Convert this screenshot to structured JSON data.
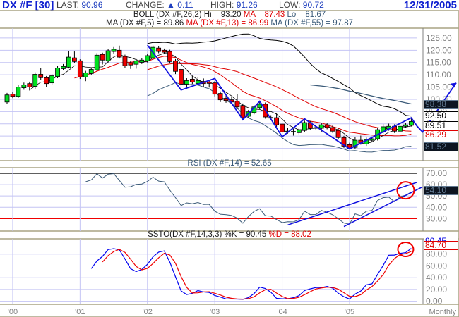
{
  "header": {
    "symbol": "DX #F [30]",
    "last_label": "LAST:",
    "last_value": "90.96",
    "change_label": "CHANGE:",
    "change_icon": "triangle-up-icon",
    "change_value": "0.11",
    "high_label": "HIGH:",
    "high_value": "91.26",
    "low_label": "LOW:",
    "low_value": "90.72",
    "date": "12/31/2005"
  },
  "legends": {
    "boll": {
      "name": "BOLL (DX #F,26,2) Hi = 93.20",
      "ma": "MA = 87.43",
      "lo": "Lo = 81.67"
    },
    "ma": {
      "ma5": "MA (DX #F,5) = 89.86",
      "ma13": "MA (DX #F,13) = 86.99",
      "ma55": "MA (DX #F,55) = 97.87"
    },
    "rsi": "RSI (DX #F,14) = 52.65",
    "ssto": {
      "k": "SSTO(DX #F,14,3,3) %K = 90.45",
      "d": "%D = 88.02"
    }
  },
  "value_boxes": {
    "main": [
      "98.38",
      "92.50",
      "89.51",
      "86.29",
      "81.52"
    ],
    "rsi": "54.10",
    "ssto_k": "90.45",
    "ssto_d": "84.70"
  },
  "x_axis": {
    "labels": [
      "'00",
      "'01",
      "'02",
      "'03",
      "'04",
      "'05"
    ],
    "label_months": [
      "2000-01",
      "2001-01",
      "2002-01",
      "2003-01",
      "2004-01",
      "2005-01"
    ],
    "periodicity": "Monthly"
  },
  "colors": {
    "up": "#00e020",
    "down": "#f00000",
    "grid": "#c4c4f4",
    "frame": "#a8a484",
    "bands": "#000000",
    "ma_red": "#e00000",
    "slate": "#3a5a78",
    "annotation": "#1010e0",
    "k": "#0000f0",
    "d": "#f00000"
  },
  "chart_data": [
    {
      "type": "candlestick",
      "periodicity": "Monthly",
      "ylim": [
        75,
        129
      ],
      "yticks": [
        "125.00",
        "120.00",
        "115.00",
        "110.00",
        "105.00",
        "100.00",
        "95.00",
        "90.00",
        "85.00",
        "80.00"
      ],
      "ytick_values": [
        125,
        120,
        115,
        110,
        105,
        100,
        95,
        90,
        85,
        80
      ],
      "grid": true,
      "dates": [
        "1999-12",
        "2000-01",
        "2000-02",
        "2000-03",
        "2000-04",
        "2000-05",
        "2000-06",
        "2000-07",
        "2000-08",
        "2000-09",
        "2000-10",
        "2000-11",
        "2000-12",
        "2001-01",
        "2001-02",
        "2001-03",
        "2001-04",
        "2001-05",
        "2001-06",
        "2001-07",
        "2001-08",
        "2001-09",
        "2001-10",
        "2001-11",
        "2001-12",
        "2002-01",
        "2002-02",
        "2002-03",
        "2002-04",
        "2002-05",
        "2002-06",
        "2002-07",
        "2002-08",
        "2002-09",
        "2002-10",
        "2002-11",
        "2002-12",
        "2003-01",
        "2003-02",
        "2003-03",
        "2003-04",
        "2003-05",
        "2003-06",
        "2003-07",
        "2003-08",
        "2003-09",
        "2003-10",
        "2003-11",
        "2003-12",
        "2004-01",
        "2004-02",
        "2004-03",
        "2004-04",
        "2004-05",
        "2004-06",
        "2004-07",
        "2004-08",
        "2004-09",
        "2004-10",
        "2004-11",
        "2004-12",
        "2005-01",
        "2005-02",
        "2005-03",
        "2005-04",
        "2005-05",
        "2005-06",
        "2005-07",
        "2005-08",
        "2005-09",
        "2005-10",
        "2005-11",
        "2005-12"
      ],
      "ohlc": [
        [
          98.9,
          102.6,
          98.1,
          101.8
        ],
        [
          102.1,
          103.0,
          100.5,
          101.2
        ],
        [
          101.2,
          105.8,
          100.6,
          105.0
        ],
        [
          104.7,
          106.8,
          103.9,
          105.9
        ],
        [
          106.4,
          107.2,
          103.6,
          105.0
        ],
        [
          105.3,
          111.0,
          104.2,
          110.2
        ],
        [
          110.2,
          112.9,
          108.0,
          108.8
        ],
        [
          108.8,
          109.5,
          105.1,
          106.4
        ],
        [
          106.7,
          110.3,
          106.0,
          109.6
        ],
        [
          109.3,
          113.6,
          108.6,
          112.8
        ],
        [
          112.5,
          114.4,
          111.8,
          113.4
        ],
        [
          113.1,
          119.6,
          112.6,
          117.2
        ],
        [
          116.9,
          119.5,
          114.8,
          115.4
        ],
        [
          115.7,
          116.3,
          108.3,
          109.1
        ],
        [
          109.1,
          111.6,
          107.4,
          110.8
        ],
        [
          110.5,
          112.9,
          109.8,
          112.2
        ],
        [
          112.0,
          118.8,
          111.5,
          118.0
        ],
        [
          118.3,
          119.0,
          114.2,
          116.0
        ],
        [
          115.7,
          120.5,
          115.0,
          119.8
        ],
        [
          119.5,
          121.3,
          118.7,
          120.4
        ],
        [
          120.0,
          121.9,
          116.6,
          117.2
        ],
        [
          117.5,
          118.2,
          112.9,
          113.7
        ],
        [
          114.9,
          115.6,
          112.4,
          114.0
        ],
        [
          114.3,
          116.4,
          112.5,
          115.7
        ],
        [
          115.1,
          116.7,
          114.4,
          116.0
        ],
        [
          115.7,
          118.5,
          115.0,
          117.8
        ],
        [
          116.9,
          121.9,
          116.2,
          121.2
        ],
        [
          120.9,
          121.6,
          118.8,
          119.5
        ],
        [
          120.0,
          120.7,
          118.5,
          119.2
        ],
        [
          119.5,
          120.2,
          114.7,
          115.4
        ],
        [
          115.7,
          116.4,
          110.3,
          111.4
        ],
        [
          112.2,
          112.9,
          105.3,
          106.2
        ],
        [
          106.2,
          108.6,
          104.2,
          107.6
        ],
        [
          108.2,
          109.5,
          106.3,
          107.0
        ],
        [
          106.4,
          108.9,
          105.7,
          107.6
        ],
        [
          107.3,
          108.5,
          105.0,
          106.4
        ],
        [
          107.0,
          107.8,
          104.8,
          106.5
        ],
        [
          106.7,
          107.4,
          101.2,
          102.1
        ],
        [
          102.4,
          103.2,
          98.9,
          99.8
        ],
        [
          100.4,
          101.5,
          98.6,
          99.5
        ],
        [
          99.8,
          101.0,
          98.0,
          98.9
        ],
        [
          99.2,
          102.2,
          96.0,
          96.9
        ],
        [
          97.5,
          98.3,
          91.8,
          92.5
        ],
        [
          93.1,
          95.7,
          92.4,
          94.9
        ],
        [
          94.6,
          97.6,
          93.9,
          96.9
        ],
        [
          96.6,
          99.4,
          95.9,
          98.0
        ],
        [
          98.0,
          98.7,
          92.1,
          92.8
        ],
        [
          92.6,
          93.5,
          91.6,
          92.5
        ],
        [
          92.5,
          94.2,
          88.8,
          89.6
        ],
        [
          89.9,
          90.6,
          85.9,
          86.7
        ],
        [
          86.7,
          88.2,
          86.0,
          87.0
        ],
        [
          86.8,
          88.0,
          85.2,
          86.9
        ],
        [
          86.4,
          88.4,
          85.7,
          87.6
        ],
        [
          87.3,
          91.3,
          86.6,
          90.5
        ],
        [
          90.5,
          91.2,
          87.5,
          88.2
        ],
        [
          88.5,
          89.5,
          87.7,
          88.2
        ],
        [
          88.2,
          90.3,
          86.8,
          89.6
        ],
        [
          89.6,
          90.3,
          87.8,
          88.5
        ],
        [
          88.5,
          89.4,
          86.3,
          87.0
        ],
        [
          87.3,
          88.1,
          83.6,
          84.4
        ],
        [
          84.4,
          85.1,
          80.2,
          80.9
        ],
        [
          81.5,
          82.3,
          79.8,
          80.0
        ],
        [
          80.4,
          84.5,
          79.9,
          83.3
        ],
        [
          83.3,
          85.2,
          81.5,
          82.1
        ],
        [
          81.8,
          84.4,
          81.0,
          83.6
        ],
        [
          83.3,
          84.8,
          82.6,
          83.9
        ],
        [
          83.9,
          88.4,
          83.2,
          87.6
        ],
        [
          86.7,
          89.9,
          86.0,
          88.8
        ],
        [
          87.9,
          90.1,
          87.2,
          89.0
        ],
        [
          89.0,
          89.8,
          86.3,
          87.0
        ],
        [
          87.0,
          89.7,
          85.8,
          89.0
        ],
        [
          89.0,
          90.5,
          88.4,
          89.6
        ],
        [
          89.4,
          92.2,
          88.9,
          90.96
        ]
      ],
      "overlays": [
        "BOLL 26,2",
        "MA 5",
        "MA 13",
        "MA 55"
      ],
      "annotations": {
        "zigzag": [
          [
            "2002-01",
            122.1
          ],
          [
            "2002-07",
            103.8
          ],
          [
            "2003-01",
            108.5
          ],
          [
            "2003-06",
            91.7
          ],
          [
            "2003-09",
            99.2
          ],
          [
            "2004-01",
            84.7
          ],
          [
            "2004-05",
            92.0
          ],
          [
            "2005-01",
            79.8
          ],
          [
            "2005-12",
            92.5
          ],
          [
            "2006-01",
            89.1
          ],
          [
            "2006-02",
            86.7
          ],
          [
            "2006-08",
            106.7
          ]
        ]
      }
    },
    {
      "type": "line",
      "title": "RSI (DX #F,14) = 52.65",
      "ylim": [
        19,
        75
      ],
      "yticks": [
        "70.00",
        "60.00",
        "50.00",
        "40.00",
        "30.00"
      ],
      "ytick_values": [
        70,
        60,
        50,
        40,
        30
      ],
      "levels": [
        70,
        30
      ],
      "trendlines": [
        [
          [
            "2004-02",
            24.4
          ],
          [
            "2006-01",
            62.0
          ]
        ],
        [
          [
            "2004-12",
            23.0
          ],
          [
            "2006-02",
            58.0
          ]
        ]
      ],
      "highlight_circle": [
        "2005-11",
        55
      ]
    },
    {
      "type": "line",
      "title": "SSTO(DX #F,14,3,3) %K = 90.45 %D = 88.02",
      "ylim": [
        -4,
        106
      ],
      "yticks": [
        "80.00",
        "60.00",
        "40.00",
        "20.00",
        "0.00"
      ],
      "ytick_values": [
        80,
        60,
        40,
        20,
        0
      ],
      "series": [
        {
          "name": "%K"
        },
        {
          "name": "%D"
        }
      ],
      "highlight_circle": [
        "2005-11",
        88
      ]
    }
  ]
}
